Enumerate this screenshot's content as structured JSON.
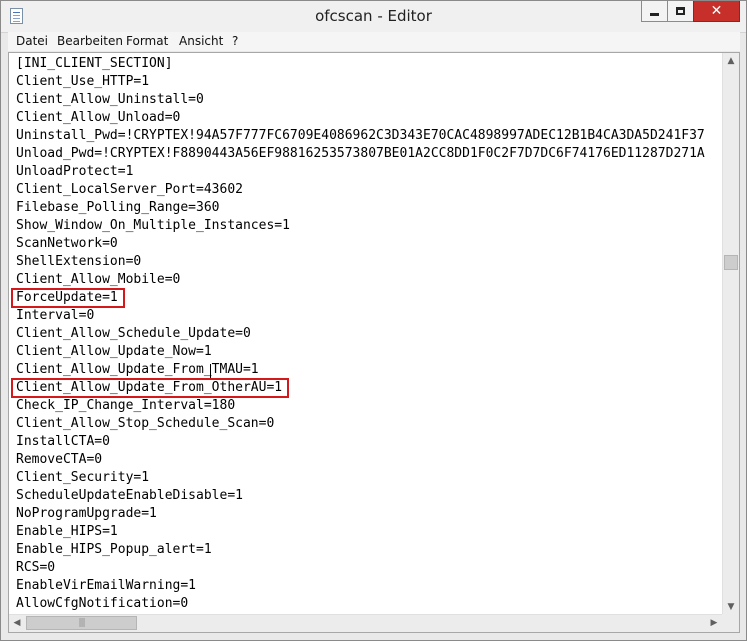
{
  "window": {
    "title": "ofcscan - Editor",
    "close_glyph": "✕"
  },
  "menu": [
    "Datei",
    "Bearbeiten",
    "Format",
    "Ansicht",
    "?"
  ],
  "editor": {
    "lines": [
      "[INI_CLIENT_SECTION]",
      "Client_Use_HTTP=1",
      "Client_Allow_Uninstall=0",
      "Client_Allow_Unload=0",
      "Uninstall_Pwd=!CRYPTEX!94A57F777FC6709E4086962C3D343E70CAC4898997ADEC12B1B4CA3DA5D241F37",
      "Unload_Pwd=!CRYPTEX!F8890443A56EF98816253573807BE01A2CC8DD1F0C2F7D7DC6F74176ED11287D271A",
      "UnloadProtect=1",
      "Client_LocalServer_Port=43602",
      "Filebase_Polling_Range=360",
      "Show_Window_On_Multiple_Instances=1",
      "ScanNetwork=0",
      "ShellExtension=0",
      "Client_Allow_Mobile=0",
      "ForceUpdate=1",
      "Interval=0",
      "Client_Allow_Schedule_Update=0",
      "Client_Allow_Update_Now=1",
      "Client_Allow_Update_From_TMAU=1",
      "Client_Allow_Update_From_OtherAU=1",
      "Check_IP_Change_Interval=180",
      "Client_Allow_Stop_Schedule_Scan=0",
      "InstallCTA=0",
      "RemoveCTA=0",
      "Client_Security=1",
      "ScheduleUpdateEnableDisable=1",
      "NoProgramUpgrade=1",
      "Enable_HIPS=1",
      "Enable_HIPS_Popup_alert=1",
      "RCS=0",
      "EnableVirEmailWarning=1",
      "AllowCfgNotification=0"
    ],
    "highlighted_lines": [
      13,
      18
    ]
  },
  "scrollbars": {
    "up_arrow": "▲",
    "down_arrow": "▼",
    "left_arrow": "◀",
    "right_arrow": "▶",
    "grip": "|||"
  },
  "colors": {
    "highlight_border": "#d3191c",
    "close_button": "#c7302a"
  }
}
